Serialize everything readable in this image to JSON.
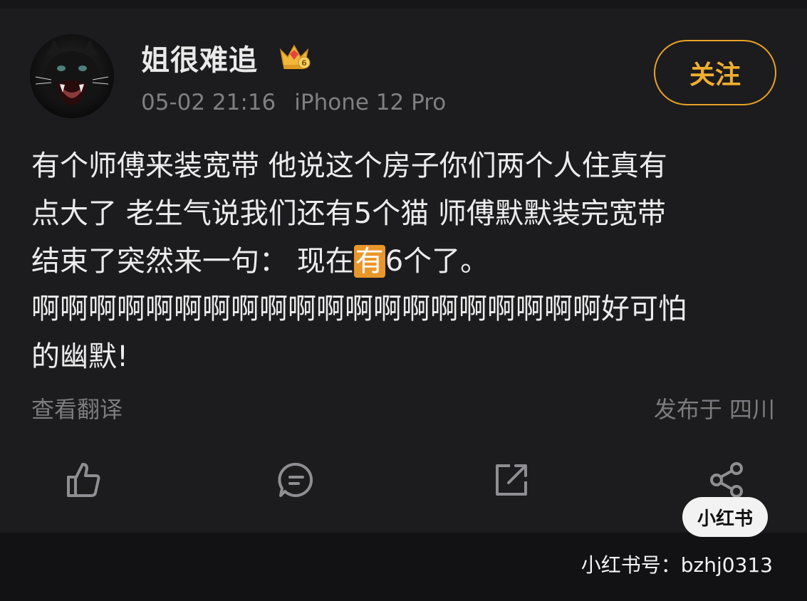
{
  "user": {
    "name": "姐很难追",
    "badge_icon": "crown-badge-icon",
    "badge_level": "6",
    "post_time": "05-02 21:16",
    "device": "iPhone 12 Pro"
  },
  "follow_button": {
    "label": "关注"
  },
  "post": {
    "line1": "有个师傅来装宽带 他说这个房子你们两个人住真有",
    "line2": "点大了 老生气说我们还有5个猫 师傅默默装完宽带",
    "line3_before": "结束了突然来一句： 现在",
    "line3_highlight": "有",
    "line3_after": "6个了。",
    "line4": "啊啊啊啊啊啊啊啊啊啊啊啊啊啊啊啊啊啊啊啊好可怕",
    "line5": "的幽默!"
  },
  "translate_label": "查看翻译",
  "location_label": "发布于 四川",
  "actions": {
    "like_icon": "thumbs-up-icon",
    "comment_icon": "comment-bubble-icon",
    "repost_icon": "repost-arrow-icon",
    "share_icon": "share-nodes-icon"
  },
  "watermark": {
    "logo_text": "小红书",
    "id_text": "小红书号：bzhj0313"
  },
  "colors": {
    "background": "#1c1c1e",
    "accent": "#e9a227",
    "highlight": "#e9962a",
    "muted_text": "#7f7f84"
  }
}
